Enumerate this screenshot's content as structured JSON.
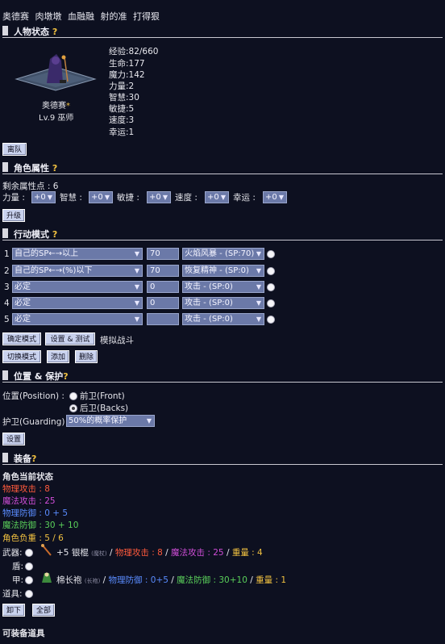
{
  "party": [
    "奥德赛",
    "肉墩墩",
    "血融融",
    "射的准",
    "打得狠"
  ],
  "sections": {
    "status": "人物状态",
    "attributes": "角色属性",
    "action": "行动模式",
    "position": "位置 & 保护",
    "equipment": "装备"
  },
  "help_mark": "?",
  "character": {
    "name": "奥德赛",
    "name_mark": "*",
    "level_class": "Lv.9 巫师",
    "stats": [
      {
        "label": "经验",
        "value": ":82/660"
      },
      {
        "label": "生命",
        "value": ":177"
      },
      {
        "label": "魔力",
        "value": ":142"
      },
      {
        "label": "力量",
        "value": ":2"
      },
      {
        "label": "智慧",
        "value": ":30"
      },
      {
        "label": "敏捷",
        "value": ":5"
      },
      {
        "label": "速度",
        "value": ":3"
      },
      {
        "label": "幸运",
        "value": ":1"
      }
    ],
    "leave_button": "离队"
  },
  "attributes": {
    "remaining": "剩余属性点 : 6",
    "fields": [
      {
        "label": "力量 :",
        "value": "+0"
      },
      {
        "label": "智慧 :",
        "value": "+0"
      },
      {
        "label": "敏捷 :",
        "value": "+0"
      },
      {
        "label": "速度 :",
        "value": "+0"
      },
      {
        "label": "幸运 :",
        "value": "+0"
      }
    ],
    "upgrade_button": "升级"
  },
  "action": {
    "rows": [
      {
        "num": "1",
        "condition": "自己的SP←→以上",
        "value": "70",
        "skill": "火焰风暴 - (SP:70)"
      },
      {
        "num": "2",
        "condition": "自己的SP←→(%)以下",
        "value": "70",
        "skill": "恢复精神 - (SP:0)"
      },
      {
        "num": "3",
        "condition": "必定",
        "value": "0",
        "skill": "攻击 - (SP:0)"
      },
      {
        "num": "4",
        "condition": "必定",
        "value": "0",
        "skill": "攻击 - (SP:0)"
      },
      {
        "num": "5",
        "condition": "必定",
        "value": "",
        "skill": "攻击 - (SP:0)"
      }
    ],
    "confirm_button": "确定模式",
    "set_test_button": "设置 & 测试",
    "simulate_label": "模拟战斗",
    "switch_button": "切换模式",
    "add_button": "添加",
    "delete_button": "删除"
  },
  "position": {
    "label": "位置(Position) :",
    "front": "前卫(Front)",
    "back": "后卫(Backs)",
    "guard_label": "护卫(Guarding) :",
    "guard_value": "50%的概率保护",
    "set_button": "设置"
  },
  "equipment": {
    "status_title": "角色当前状态",
    "lines": [
      {
        "text": "物理攻击 : 8",
        "color": "#ff5a3c"
      },
      {
        "text": "魔法攻击 : 25",
        "color": "#d04ed8"
      },
      {
        "text": "物理防御 : 0 + 5",
        "color": "#5a8cff"
      },
      {
        "text": "魔法防御 : 30 + 10",
        "color": "#5ad05a"
      },
      {
        "text": "角色负重 : 5 / 6",
        "color": "#f0c040"
      }
    ],
    "slots": {
      "weapon_label": "武器:",
      "weapon_name": "+5 银棍",
      "weapon_tag": "(魔杖)",
      "weapon_patk": "物理攻击 : 8",
      "weapon_matk": "魔法攻击 : 25",
      "weapon_weight": "重量 : 4",
      "shield_label": "盾:",
      "armor_label": "甲:",
      "armor_name": "棉长袍",
      "armor_tag": "(长袍)",
      "armor_pdef": "物理防御 : 0+5",
      "armor_mdef": "魔法防御 : 30+10",
      "armor_weight": "重量 : 1",
      "item_label": "道具:"
    },
    "unequip_button": "卸下",
    "all_button": "全部",
    "available_title": "可装备道具"
  },
  "sep": "/",
  "icons": {
    "help": "question-mark",
    "weapon": "staff-icon",
    "armor": "robe-icon",
    "avatar": "wizard-avatar"
  }
}
